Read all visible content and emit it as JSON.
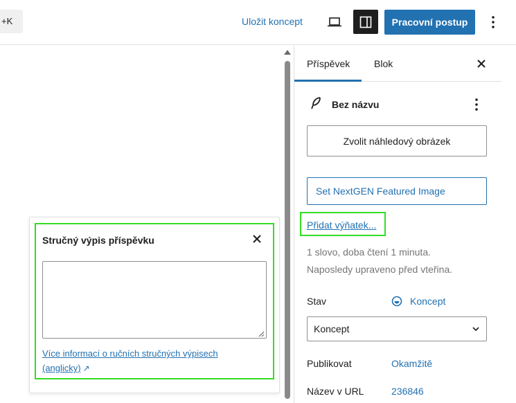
{
  "topbar": {
    "shortcut_fragment": "+K",
    "save_draft_label": "Uložit koncept",
    "publish_label": "Pracovní postup",
    "icons": {
      "preview": "laptop-icon",
      "settings": "sidebar-toggle-icon",
      "options": "more-vertical-icon"
    }
  },
  "excerpt_popover": {
    "title": "Stručný výpis příspěvku",
    "textarea_value": "",
    "help_link": "Více informací o ručních stručných výpisech (anglicky)",
    "help_link_arrow": "↗"
  },
  "sidebar": {
    "tabs": [
      {
        "label": "Příspěvek",
        "active": true
      },
      {
        "label": "Blok",
        "active": false
      }
    ],
    "post_title": "Bez názvu",
    "featured_image_button": "Zvolit náhledový obrázek",
    "nextgen_button": "Set NextGEN Featured Image",
    "add_excerpt_link": "Přidat výňatek...",
    "word_count_line": "1 slovo, doba čtení 1 minuta.",
    "last_edited_line": "Naposledy upraveno před vteřina.",
    "status_label": "Stav",
    "status_value": "Koncept",
    "status_select_value": "Koncept",
    "publish_label": "Publikovat",
    "publish_value": "Okamžitě",
    "url_label": "Název v URL",
    "url_value": "236846"
  },
  "colors": {
    "accent": "#2271b1",
    "highlight": "#33dd22",
    "dark": "#1e1e1e",
    "muted": "#757575"
  }
}
